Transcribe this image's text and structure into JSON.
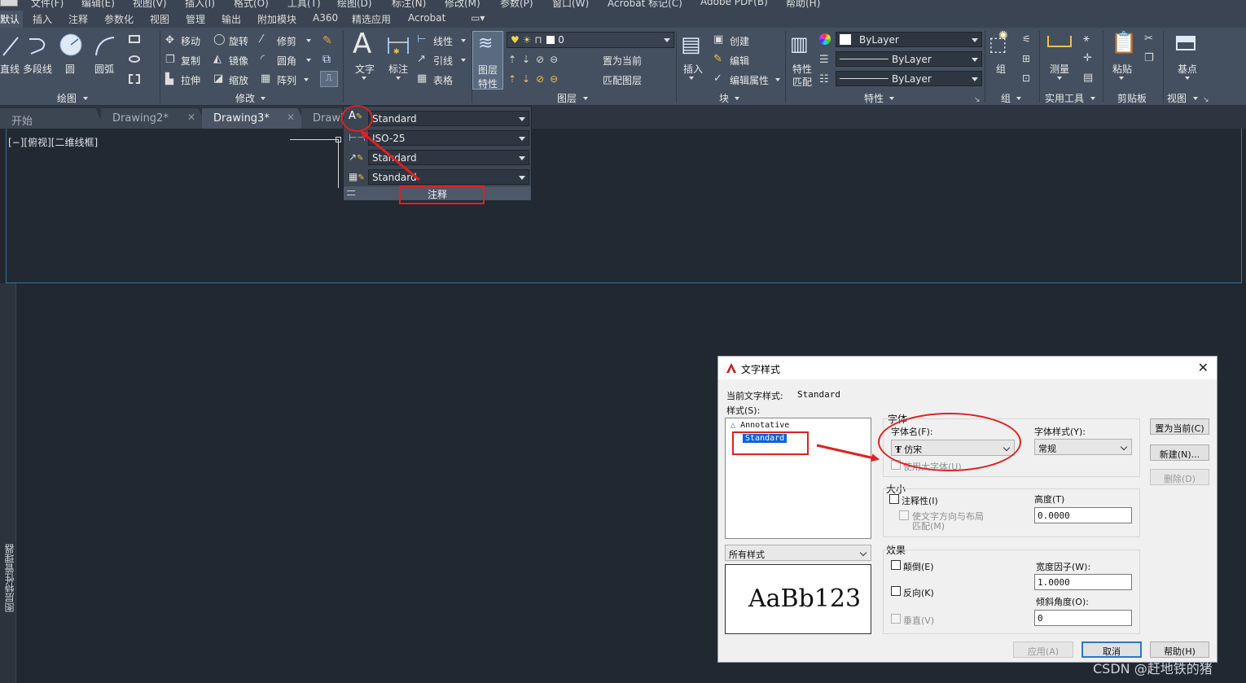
{
  "menubar": {
    "items": [
      "文件(F)",
      "编辑(E)",
      "视图(V)",
      "插入(I)",
      "格式(O)",
      "工具(T)",
      "绘图(D)",
      "标注(N)",
      "修改(M)",
      "参数(P)",
      "窗口(W)",
      "Acrobat 标记(C)",
      "Adobe PDF(B)",
      "帮助(H)"
    ]
  },
  "ribbon_tabs": [
    "默认",
    "插入",
    "注释",
    "参数化",
    "视图",
    "管理",
    "输出",
    "附加模块",
    "A360",
    "精选应用",
    "Acrobat"
  ],
  "ribbon": {
    "draw": {
      "line": "直线",
      "polyline": "多段线",
      "circle": "圆",
      "arc": "圆弧",
      "title": "绘图"
    },
    "modify": {
      "move": "移动",
      "rotate": "旋转",
      "trim": "修剪",
      "copy": "复制",
      "mirror": "镜像",
      "fillet": "圆角",
      "stretch": "拉伸",
      "scale": "缩放",
      "array": "阵列",
      "title": "修改"
    },
    "annotation": {
      "text": "文字",
      "dimension": "标注",
      "linear": "线性",
      "leader": "引线",
      "table": "表格"
    },
    "layers": {
      "layer_props": "图层",
      "layer_props2": "特性",
      "current_layer": "0",
      "make_current": "置为当前",
      "match_layer": "匹配图层",
      "title": "图层"
    },
    "block": {
      "insert": "插入",
      "create": "创建",
      "edit": "编辑",
      "edit_attr": "编辑属性",
      "title": "块"
    },
    "properties": {
      "match": "特性",
      "match2": "匹配",
      "color": "ByLayer",
      "linetype": "ByLayer",
      "lineweight": "ByLayer",
      "title": "特性"
    },
    "groups": {
      "group": "组",
      "title": "组"
    },
    "utilities": {
      "measure": "测量",
      "title": "实用工具"
    },
    "clipboard": {
      "paste": "粘贴",
      "title": "剪贴板"
    },
    "view": {
      "base": "基点",
      "title": "视图"
    }
  },
  "file_tabs": [
    {
      "label": "开始"
    },
    {
      "label": "Drawing2*"
    },
    {
      "label": "Drawing3*"
    },
    {
      "label": "Drawi"
    }
  ],
  "viewport": {
    "label": "[−][俯视][二维线框]"
  },
  "left_strip": {
    "label": "图层特性管理器"
  },
  "annot_flyout": {
    "text_style": "Standard",
    "dim_style": "ISO-25",
    "leader_style": "Standard",
    "table_style": "Standard",
    "title": "注释"
  },
  "dialog": {
    "title": "文字样式",
    "current_style_label": "当前文字样式:",
    "current_style_value": "Standard",
    "styles_label": "样式(S):",
    "styles": [
      "Annotative",
      "Standard"
    ],
    "filter": "所有样式",
    "preview": "AaBb123",
    "font_group": "字体",
    "font_name_label": "字体名(F):",
    "font_name": "仿宋",
    "font_style_label": "字体样式(Y):",
    "font_style": "常规",
    "big_font": "使用大字体(U)",
    "size_group": "大小",
    "annotative": "注释性(I)",
    "match_layout_1": "使文字方向与布局",
    "match_layout_2": "匹配(M)",
    "height_label": "高度(T)",
    "height": "0.0000",
    "effects_group": "效果",
    "upside_down": "颠倒(E)",
    "backwards": "反向(K)",
    "vertical": "垂直(V)",
    "width_label": "宽度因子(W):",
    "width": "1.0000",
    "oblique_label": "倾斜角度(O):",
    "oblique": "0",
    "btn_set_current": "置为当前(C)",
    "btn_new": "新建(N)...",
    "btn_delete": "删除(D)",
    "btn_apply": "应用(A)",
    "btn_cancel": "取消",
    "btn_help": "帮助(H)"
  },
  "watermark": "CSDN @赶地铁的猪",
  "colors": {
    "accent_red": "#e02020",
    "selection_blue": "#0a64d6",
    "ribbon_bg": "#44505f"
  }
}
